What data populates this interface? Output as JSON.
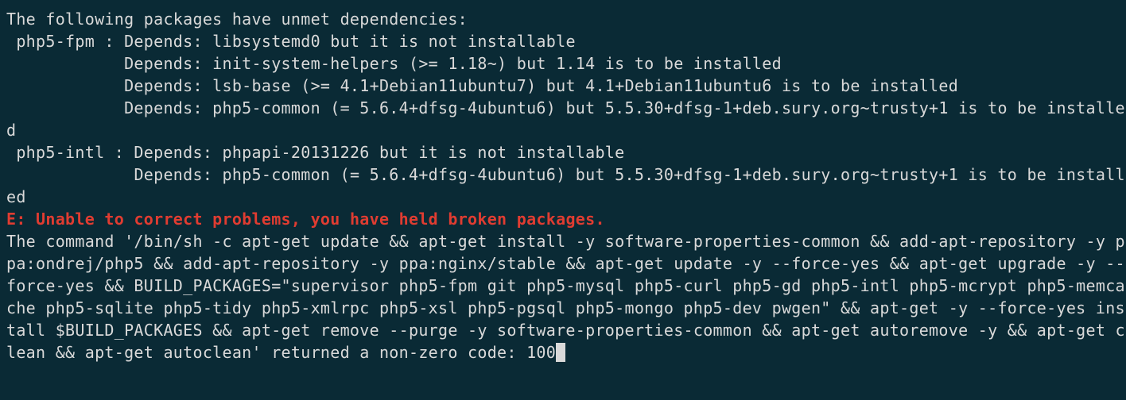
{
  "terminal": {
    "line1": "The following packages have unmet dependencies:",
    "line2": " php5-fpm : Depends: libsystemd0 but it is not installable",
    "line3": "            Depends: init-system-helpers (>= 1.18~) but 1.14 is to be installed",
    "line4": "            Depends: lsb-base (>= 4.1+Debian11ubuntu7) but 4.1+Debian11ubuntu6 is to be installed",
    "line5": "            Depends: php5-common (= 5.6.4+dfsg-4ubuntu6) but 5.5.30+dfsg-1+deb.sury.org~trusty+1 is to be installed",
    "line6": " php5-intl : Depends: phpapi-20131226 but it is not installable",
    "line7": "             Depends: php5-common (= 5.6.4+dfsg-4ubuntu6) but 5.5.30+dfsg-1+deb.sury.org~trusty+1 is to be installed",
    "error_prefix": "E:",
    "error_message": " Unable to correct problems, you have held broken packages.",
    "command_output": "The command '/bin/sh -c apt-get update && apt-get install -y software-properties-common && add-apt-repository -y ppa:ondrej/php5 && add-apt-repository -y ppa:nginx/stable && apt-get update -y --force-yes && apt-get upgrade -y --force-yes && BUILD_PACKAGES=\"supervisor php5-fpm git php5-mysql php5-curl php5-gd php5-intl php5-mcrypt php5-memcache php5-sqlite php5-tidy php5-xmlrpc php5-xsl php5-pgsql php5-mongo php5-dev pwgen\" && apt-get -y --force-yes install $BUILD_PACKAGES && apt-get remove --purge -y software-properties-common && apt-get autoremove -y && apt-get clean && apt-get autoclean' returned a non-zero code: 100"
  }
}
